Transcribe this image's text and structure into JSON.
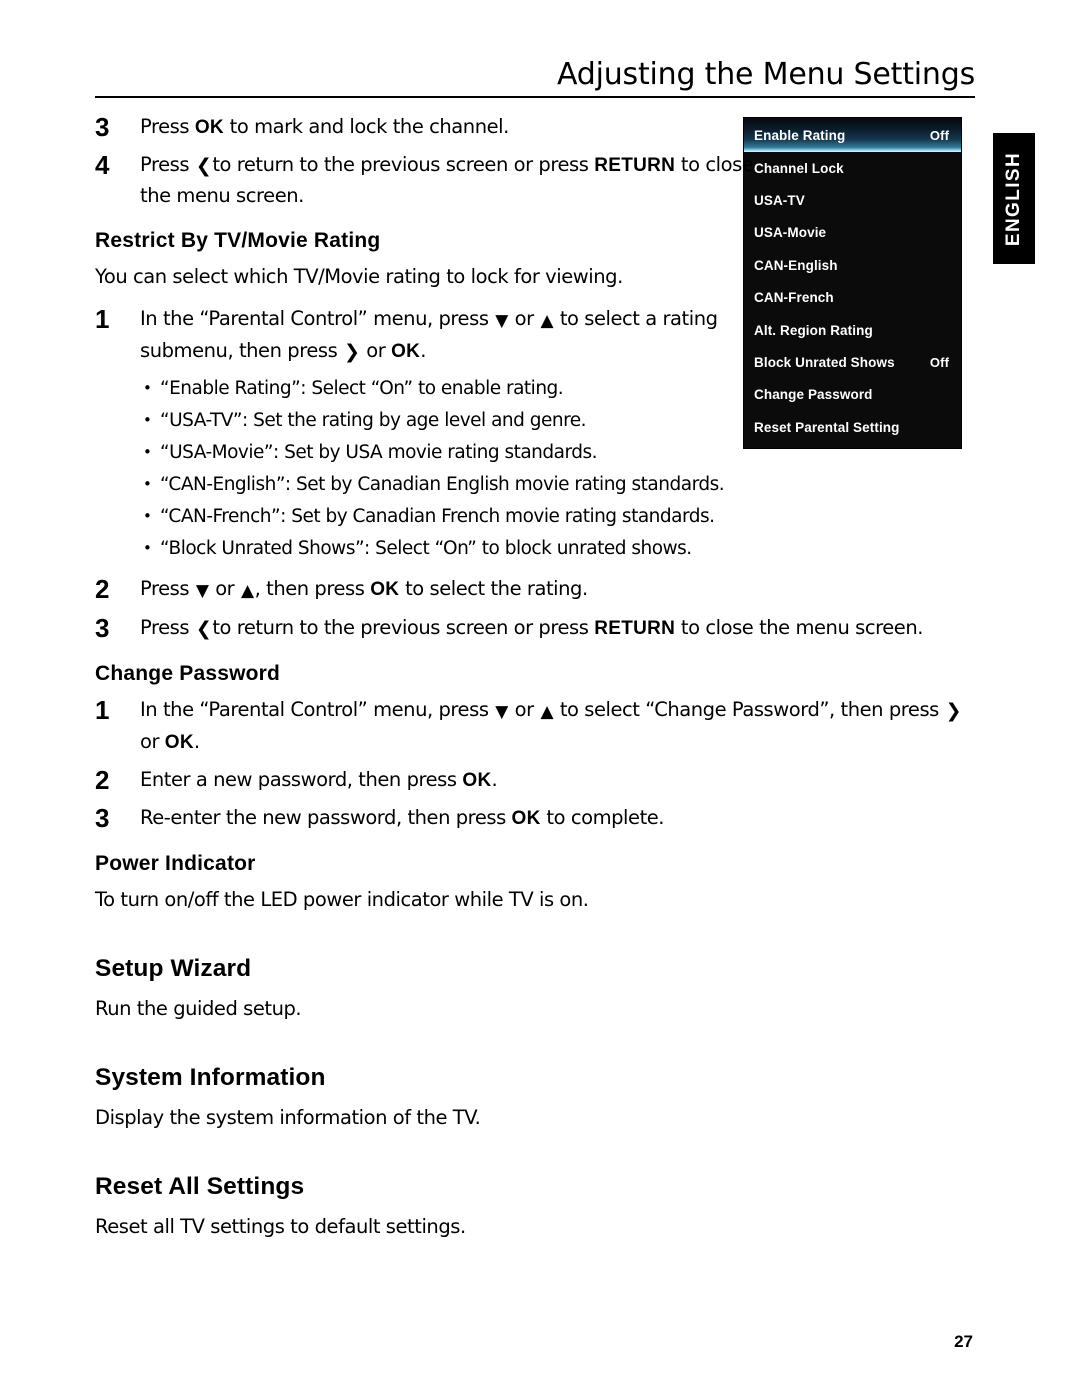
{
  "header": {
    "title": "Adjusting the Menu Settings"
  },
  "language_tab": {
    "label": "ENGLISH"
  },
  "page_number": "27",
  "steps_top": [
    {
      "num": "3",
      "parts": [
        {
          "t": "Press ",
          "s": "normal"
        },
        {
          "t": "OK",
          "s": "kbd"
        },
        {
          "t": " to mark and lock the channel.",
          "s": "normal"
        }
      ],
      "plain": "Press OK to mark and lock the channel."
    },
    {
      "num": "4",
      "parts": [
        {
          "t": "Press ",
          "s": "normal"
        },
        {
          "t": "‹",
          "s": "arrow"
        },
        {
          "t": "to return to the previous screen or press ",
          "s": "normal"
        },
        {
          "t": "RETURN",
          "s": "kbd"
        },
        {
          "t": " to close the menu screen.",
          "s": "normal"
        }
      ],
      "plain": "Press ‹ to return to the previous screen or press RETURN to close the menu screen."
    }
  ],
  "section_restrict": {
    "heading": "Restrict By TV/Movie Rating",
    "intro": "You can select which TV/Movie rating to lock for viewing.",
    "step1_num": "1",
    "step1_text": "In the “Parental Control” menu, press ▼ or ▲ to select a rating submenu, then press › or OK.",
    "bullets": [
      "“Enable Rating”: Select “On” to enable rating.",
      "“USA-TV”: Set the rating by age level and genre.",
      "“USA-Movie”: Set by USA movie rating standards.",
      "“CAN-English”: Set by Canadian English movie rating standards.",
      "“CAN-French”: Set by Canadian French movie rating standards.",
      "“Block Unrated Shows”: Select “On” to block unrated shows."
    ],
    "step2_num": "2",
    "step2_text": "Press ▼ or ▲, then press OK to select the rating.",
    "step3_num": "3",
    "step3_text": "Press ‹ to return to the previous screen or press RETURN to close the menu screen."
  },
  "section_change_password": {
    "heading": "Change Password",
    "step1_num": "1",
    "step1_text": "In the “Parental Control” menu, press ▼ or ▲ to select “Change Password”, then press › or OK.",
    "step2_num": "2",
    "step2_text": "Enter a new password, then press OK.",
    "step3_num": "3",
    "step3_text": "Re-enter the new password, then press OK to complete."
  },
  "section_power_indicator": {
    "heading": "Power Indicator",
    "body": "To turn on/off the LED power indicator while TV is on."
  },
  "section_setup_wizard": {
    "heading": "Setup Wizard",
    "body": "Run the guided setup."
  },
  "section_system_information": {
    "heading": "System Information",
    "body": "Display the system information of the TV."
  },
  "section_reset_all": {
    "heading": "Reset All Settings",
    "body": "Reset all TV settings to default settings."
  },
  "osd_menu": {
    "rows": [
      {
        "label": "Enable Rating",
        "value": "Off",
        "highlighted": true
      },
      {
        "label": "Channel Lock",
        "value": "",
        "highlighted": false
      },
      {
        "label": "USA-TV",
        "value": "",
        "highlighted": false
      },
      {
        "label": "USA-Movie",
        "value": "",
        "highlighted": false
      },
      {
        "label": "CAN-English",
        "value": "",
        "highlighted": false
      },
      {
        "label": "CAN-French",
        "value": "",
        "highlighted": false
      },
      {
        "label": "Alt. Region Rating",
        "value": "",
        "highlighted": false
      },
      {
        "label": "Block Unrated Shows",
        "value": "Off",
        "highlighted": false
      },
      {
        "label": "Change Password",
        "value": "",
        "highlighted": false
      },
      {
        "label": "Reset Parental Setting",
        "value": "",
        "highlighted": false
      }
    ],
    "colors": {
      "background": "#0b0b0b",
      "text": "#ffffff",
      "highlight_top": "#050a12",
      "highlight_bottom": "#dff3fa"
    }
  },
  "icons": {
    "chevron_left": "‹",
    "chevron_right": "›",
    "chevron_up": "▲",
    "chevron_down": "▼"
  }
}
